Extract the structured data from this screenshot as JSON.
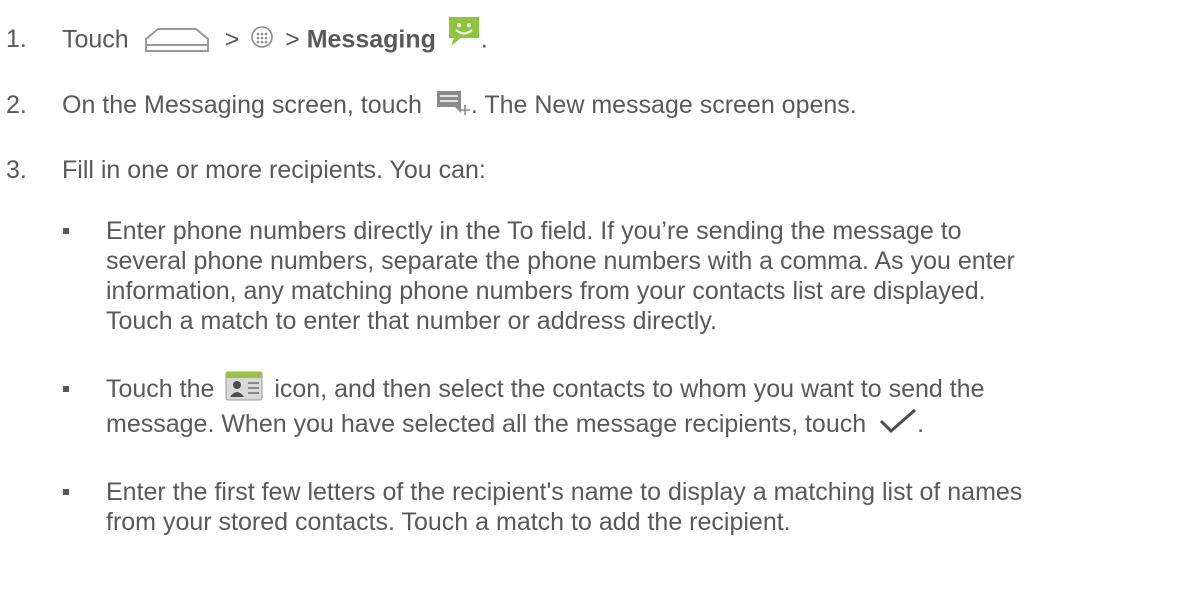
{
  "steps": [
    {
      "number": "1.",
      "touch": "Touch",
      "sep1": ">",
      "sep2": ">",
      "app_name": "Messaging",
      "end": "."
    },
    {
      "number": "2.",
      "before": "On the Messaging screen, touch",
      "after": ". The New message screen opens."
    },
    {
      "number": "3.",
      "text": "Fill in one or more recipients. You can:"
    }
  ],
  "bullets": [
    {
      "lines": [
        "Enter phone numbers directly in the To field. If you’re sending the message to",
        "several phone numbers, separate the phone numbers with a comma. As you enter",
        "information, any matching phone numbers from your contacts list are displayed.",
        "Touch a match to enter that number or address directly."
      ]
    },
    {
      "line1_before": "Touch the",
      "line1_after": "icon, and then select the contacts to whom you want to send the",
      "line2_before": "message. When you have selected all the message recipients, touch",
      "line2_after": "."
    },
    {
      "lines": [
        "Enter the first few letters of the recipient's name to display a matching list of names",
        "from your stored contacts. Touch a match to add the recipient."
      ]
    }
  ],
  "icons": {
    "home": "home-icon",
    "apps": "all-apps-icon",
    "messaging": "messaging-app-icon",
    "compose": "new-message-icon",
    "contacts": "contacts-picker-icon",
    "done": "checkmark-icon",
    "messaging_color": "#8cc63f"
  }
}
